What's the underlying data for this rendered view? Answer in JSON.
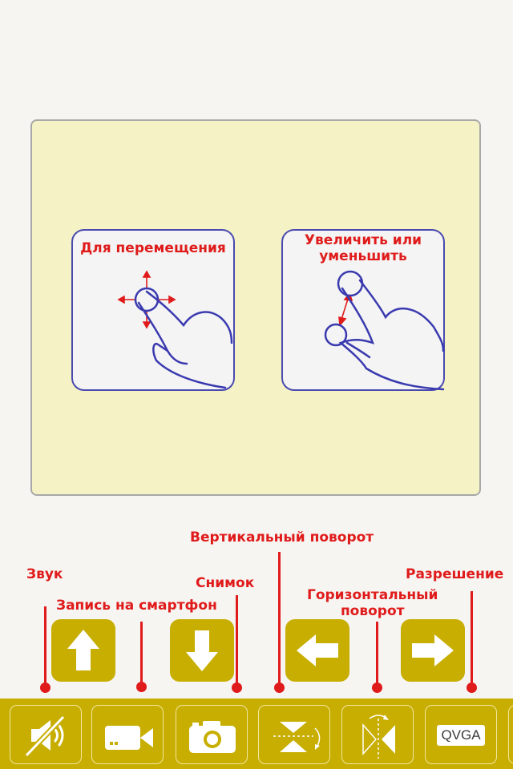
{
  "instructions": {
    "move_label": "Для перемещения",
    "zoom_label_line1": "Увеличить или",
    "zoom_label_line2": "уменьшить"
  },
  "callouts": {
    "sound": "Звук",
    "record_phone": "Запись на смартфон",
    "snapshot": "Снимок",
    "vertical_flip": "Вертикальный поворот",
    "horizontal_flip_line1": "Горизонтальный",
    "horizontal_flip_line2": "поворот",
    "resolution": "Разрешение"
  },
  "toolbar": {
    "resolution_value": "QVGA",
    "icons": [
      "sound-muted-icon",
      "video-camera-icon",
      "photo-camera-icon",
      "vertical-flip-icon",
      "horizontal-flip-icon",
      "resolution-icon"
    ]
  },
  "direction_pad": [
    "arrow-up-icon",
    "arrow-down-icon",
    "arrow-left-icon",
    "arrow-right-icon"
  ],
  "colors": {
    "accent_gold": "#c7ae00",
    "callout_red": "#e01b1b",
    "panel_yellow": "#f5f3c6",
    "gesture_blue": "#4a4ab0"
  }
}
